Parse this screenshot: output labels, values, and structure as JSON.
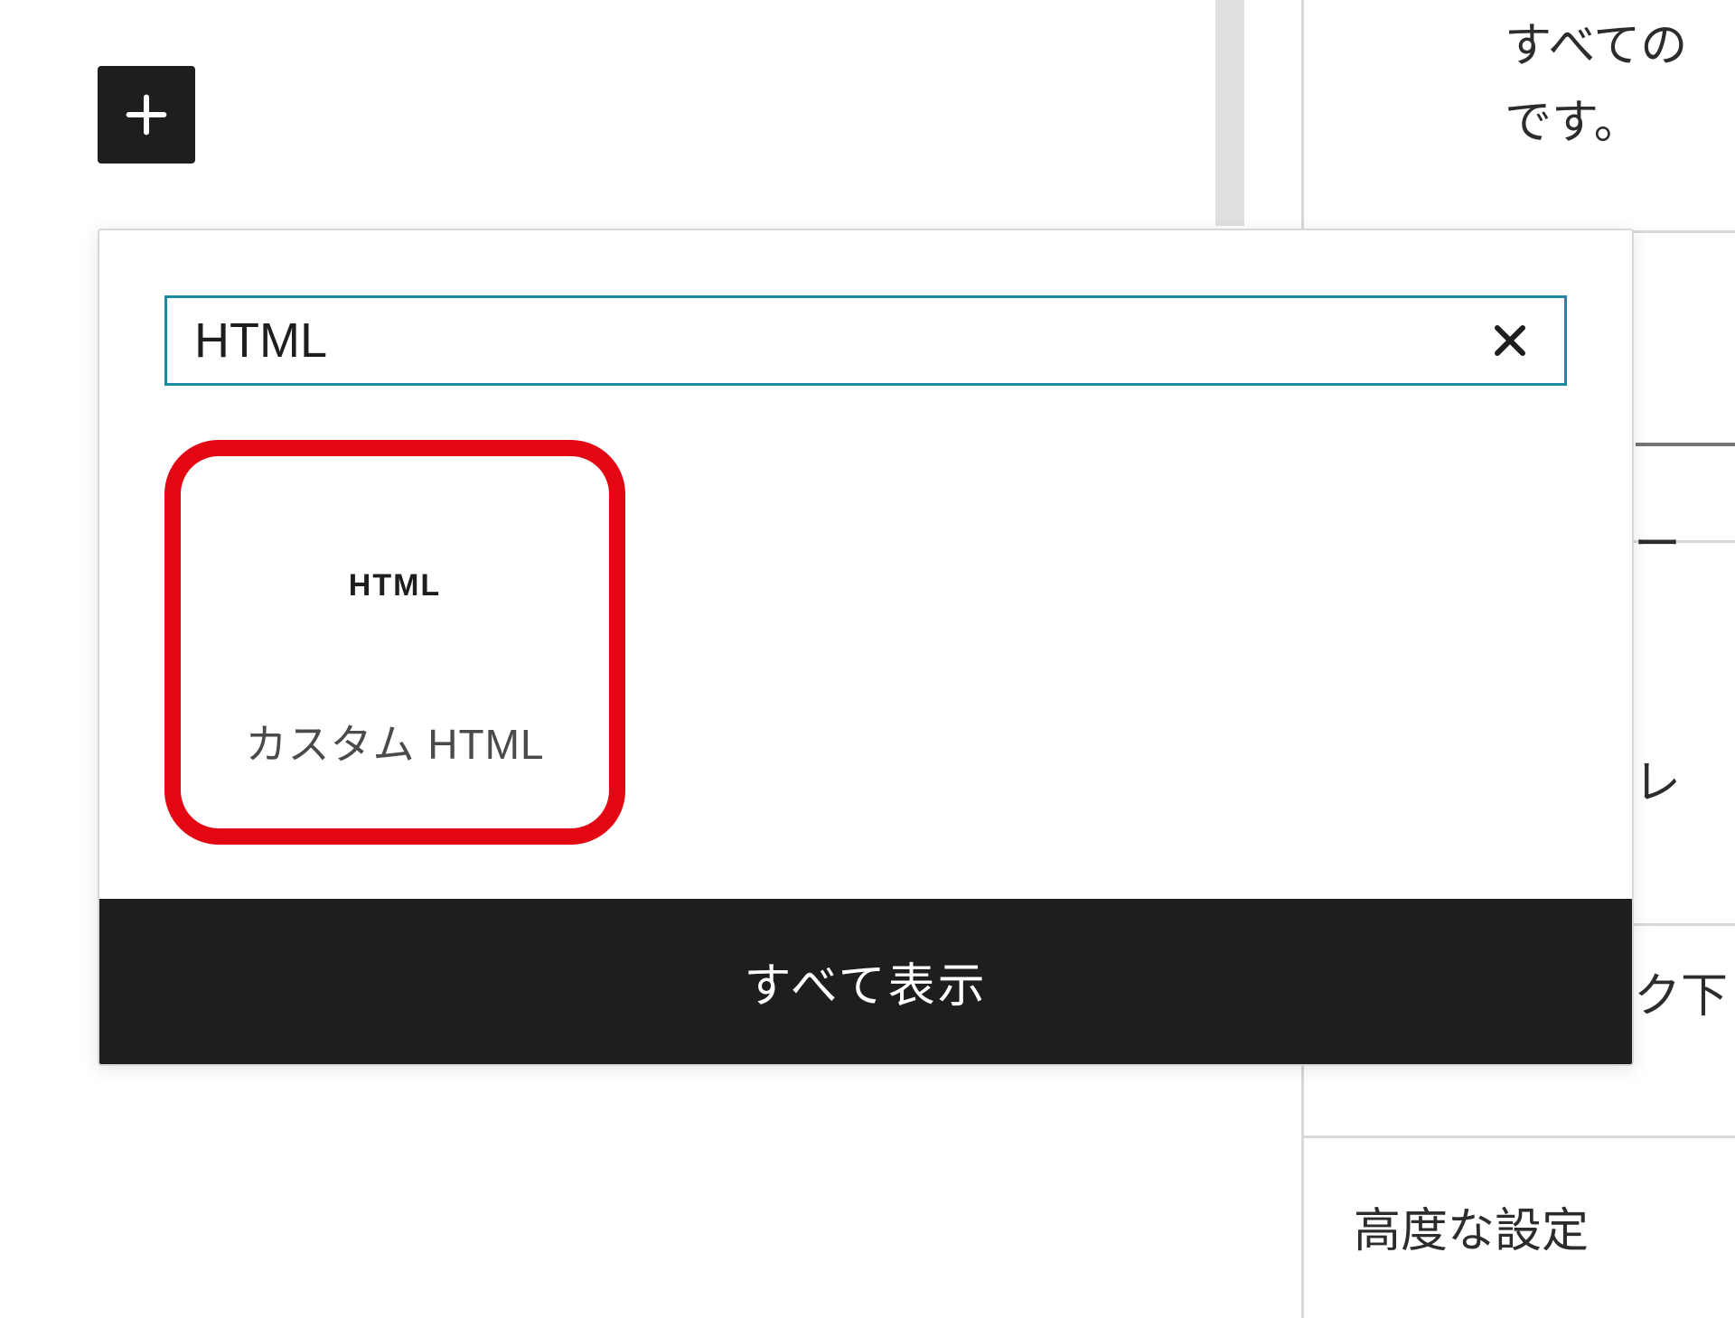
{
  "sidebar_description": {
    "line1": "すべての",
    "line2": "です。"
  },
  "inserter": {
    "search_value": "HTML",
    "block": {
      "icon_text": "HTML",
      "label": "カスタム HTML"
    },
    "browse_all_label": "すべて表示"
  },
  "sidebar_items": {
    "item1_fragment": "ー",
    "item2_fragment": "レ",
    "item3_fragment": "ク下",
    "item4_label": "高度な設定"
  }
}
